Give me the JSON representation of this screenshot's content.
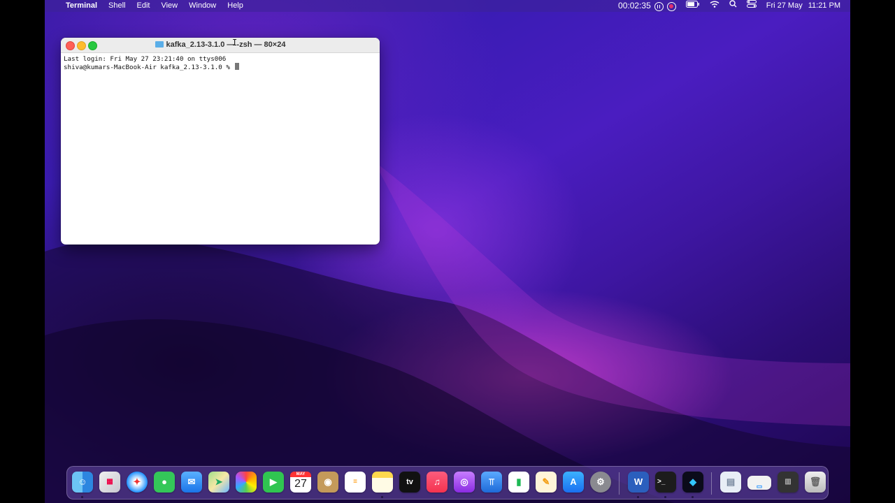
{
  "menubar": {
    "apple": "",
    "app_name": "Terminal",
    "menus": [
      "Shell",
      "Edit",
      "View",
      "Window",
      "Help"
    ],
    "recording_timer": "00:02:35",
    "date": "Fri 27 May",
    "time": "11:21 PM"
  },
  "terminal": {
    "title": "kafka_2.13-3.1.0 — -zsh — 80×24",
    "lines": [
      "Last login: Fri May 27 23:21:40 on ttys006",
      "shiva@kumars-MacBook-Air kafka_2.13-3.1.0 % "
    ]
  },
  "dock": {
    "calendar_month": "MAY",
    "calendar_day": "27",
    "tv_label": "tv",
    "word_label": "W",
    "apps": [
      "finder-icon",
      "launchpad-icon",
      "safari-icon",
      "messages-icon",
      "mail-icon",
      "maps-icon",
      "photos-icon",
      "facetime-icon",
      "calendar-icon",
      "contacts-icon",
      "reminders-icon",
      "notes-icon",
      "apple-tv-icon",
      "music-icon",
      "podcasts-icon",
      "keynote-icon",
      "numbers-icon",
      "pages-icon",
      "app-store-icon",
      "system-preferences-icon",
      "microsoft-word-icon",
      "terminal-icon",
      "app-icon",
      "document-icon",
      "window-icon",
      "stack-icon",
      "trash-icon"
    ]
  }
}
